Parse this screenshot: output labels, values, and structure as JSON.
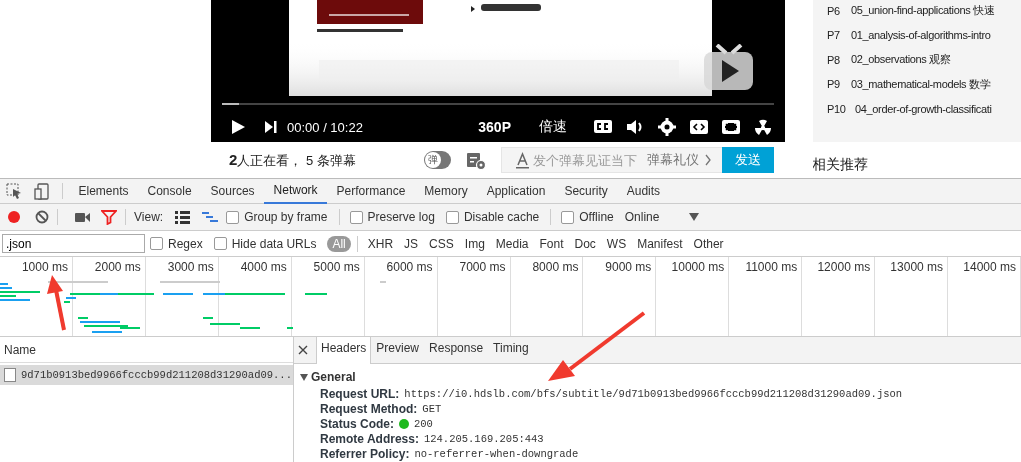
{
  "video_player": {
    "progress": {
      "level": 0.03
    },
    "time": "00:00 / 10:22",
    "quality": "360P",
    "speed": "倍速"
  },
  "video_info": {
    "viewers": "**2**人正在看， 5 条弹幕",
    "danmaku_toggle": "弹",
    "danmaku_input": {
      "placeholder": "发个弹幕见证当下"
    },
    "etiquette_link": "弹幕礼仪",
    "send_button": "发送"
  },
  "playlist": {
    "items": [
      {
        "index": "P6",
        "title": "05_union-find-applications 快速"
      },
      {
        "index": "P7",
        "title": "01_analysis-of-algorithms-intro"
      },
      {
        "index": "P8",
        "title": "02_observations 观察"
      },
      {
        "index": "P9",
        "title": "03_mathematical-models 数学"
      },
      {
        "index": "P10",
        "title": "04_order-of-growth-classificati"
      }
    ],
    "related_heading": "相关推荐"
  },
  "devtools": {
    "tabs": [
      {
        "label": "Elements",
        "selected": false
      },
      {
        "label": "Console",
        "selected": false
      },
      {
        "label": "Sources",
        "selected": false
      },
      {
        "label": "Network",
        "selected": true
      },
      {
        "label": "Performance",
        "selected": false
      },
      {
        "label": "Memory",
        "selected": false
      },
      {
        "label": "Application",
        "selected": false
      },
      {
        "label": "Security",
        "selected": false
      },
      {
        "label": "Audits",
        "selected": false
      }
    ],
    "toolbar": {
      "recording": true,
      "filter_active": true,
      "view_label": "View:",
      "options": [
        {
          "label": "Group by frame",
          "checked": false
        },
        {
          "label": "Preserve log",
          "checked": false
        },
        {
          "label": "Disable cache",
          "checked": false
        },
        {
          "label": "Offline",
          "checked": false
        }
      ],
      "throttling": "Online"
    },
    "filter_bar": {
      "value": ".json",
      "options": [
        {
          "label": "Regex",
          "checked": false
        },
        {
          "label": "Hide data URLs",
          "checked": false
        }
      ],
      "types": [
        {
          "label": "All",
          "selected": true
        },
        {
          "label": "XHR",
          "selected": false
        },
        {
          "label": "JS",
          "selected": false
        },
        {
          "label": "CSS",
          "selected": false
        },
        {
          "label": "Img",
          "selected": false
        },
        {
          "label": "Media",
          "selected": false
        },
        {
          "label": "Font",
          "selected": false
        },
        {
          "label": "Doc",
          "selected": false
        },
        {
          "label": "WS",
          "selected": false
        },
        {
          "label": "Manifest",
          "selected": false
        },
        {
          "label": "Other",
          "selected": false
        }
      ]
    },
    "timeline": {
      "ticks": [
        "1000 ms",
        "2000 ms",
        "3000 ms",
        "4000 ms",
        "5000 ms",
        "6000 ms",
        "7000 ms",
        "8000 ms",
        "9000 ms",
        "10000 ms",
        "11000 ms",
        "12000 ms",
        "13000 ms",
        "14000 ms"
      ]
    },
    "requests": {
      "column": "Name",
      "rows": [
        {
          "name": "9d71b0913bed9966fcccb99d211208d31290ad09...",
          "selected": true
        }
      ]
    },
    "details": {
      "tabs": [
        {
          "label": "Headers",
          "selected": true
        },
        {
          "label": "Preview",
          "selected": false
        },
        {
          "label": "Response",
          "selected": false
        },
        {
          "label": "Timing",
          "selected": false
        }
      ],
      "section": {
        "title": "General",
        "expanded": true,
        "rows": [
          {
            "kind": "text",
            "key": "Request URL:",
            "value": "https://i0.hdslb.com/bfs/subtitle/9d71b0913bed9966fcccb99d211208d31290ad09.json"
          },
          {
            "kind": "text",
            "key": "Request Method:",
            "value": "GET"
          },
          {
            "kind": "status",
            "key": "Status Code:",
            "value": "200",
            "color": "#1eb91e"
          },
          {
            "kind": "text",
            "key": "Remote Address:",
            "value": "124.205.169.205:443"
          },
          {
            "kind": "text",
            "key": "Referrer Policy:",
            "value": "no-referrer-when-downgrade"
          }
        ]
      }
    }
  }
}
